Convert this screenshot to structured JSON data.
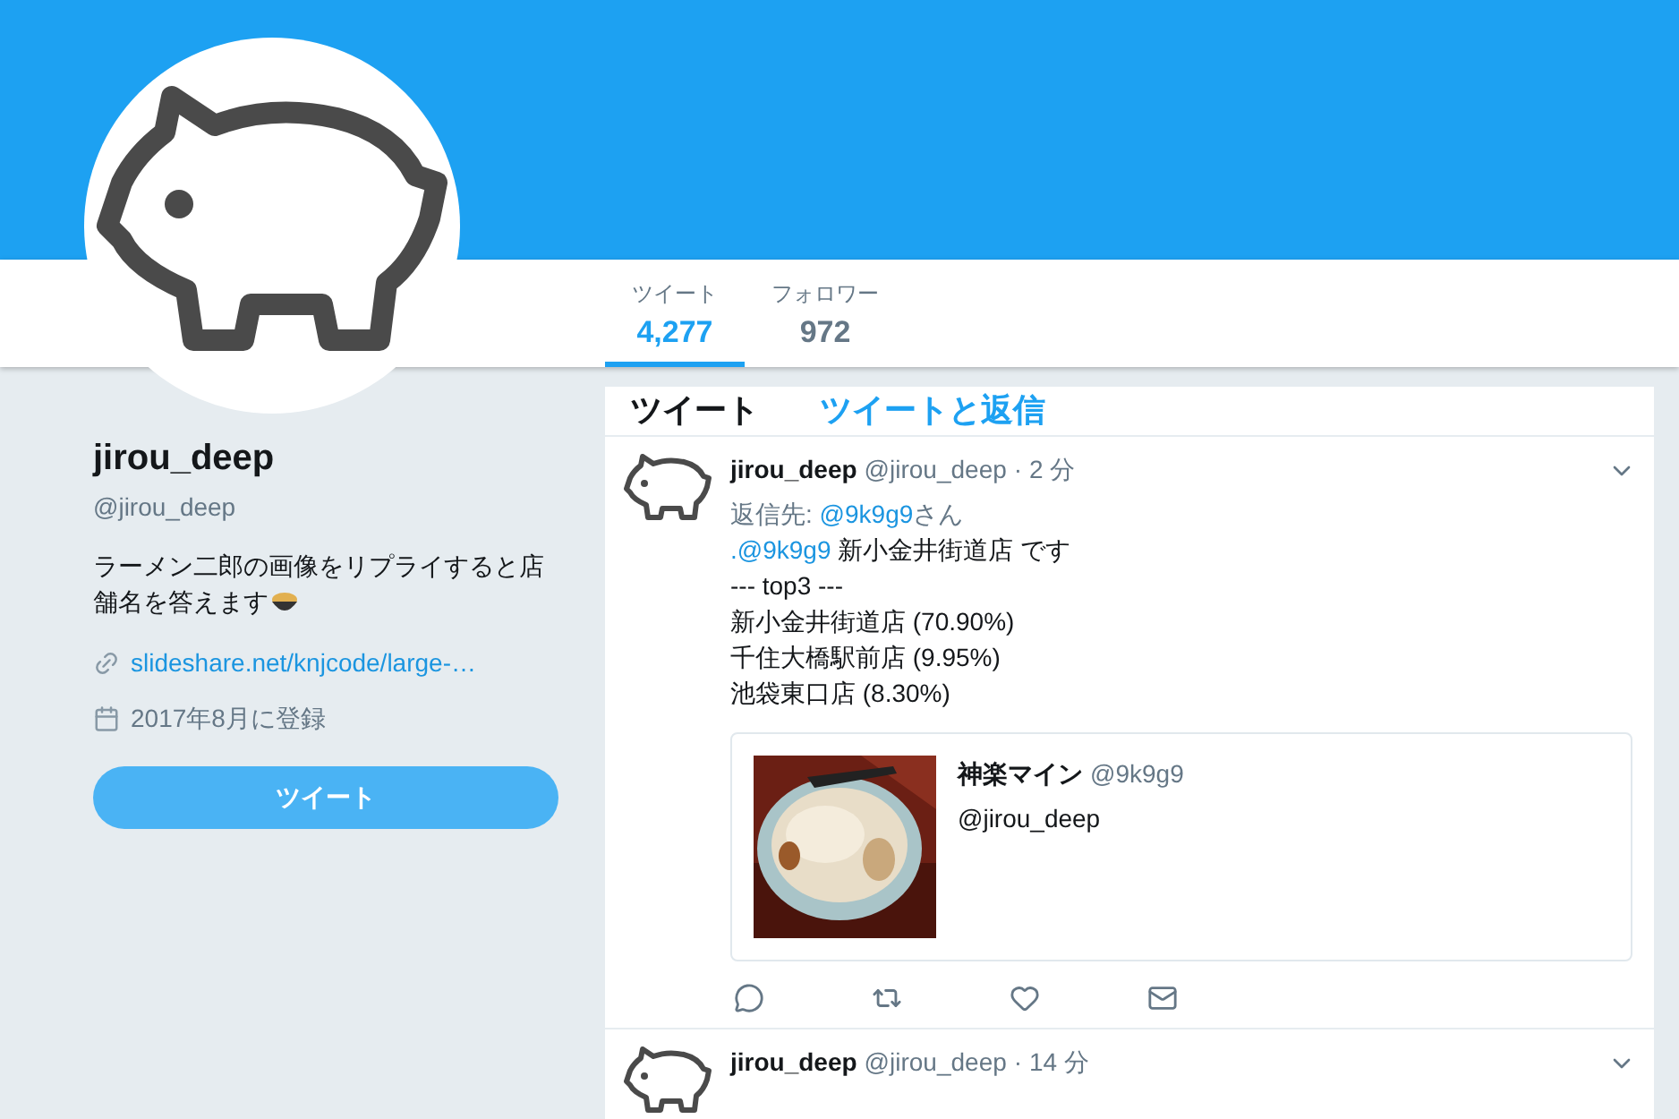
{
  "nav": {
    "stats": [
      {
        "label": "ツイート",
        "value": "4,277",
        "selected": true
      },
      {
        "label": "フォロワー",
        "value": "972",
        "selected": false
      }
    ]
  },
  "profile": {
    "name": "jirou_deep",
    "handle": "@jirou_deep",
    "bio_lines": [
      "ラーメン二郎の画像をリプライすると店",
      "舗名を答えます"
    ],
    "link": "slideshare.net/knjcode/large-…",
    "joined": "2017年8月に登録",
    "tweet_button": "ツイート"
  },
  "timeline": {
    "tabs": [
      {
        "label": "ツイート",
        "selected": true
      },
      {
        "label": "ツイートと返信",
        "selected": false
      }
    ],
    "tweets": [
      {
        "name": "jirou_deep",
        "handle": "@jirou_deep",
        "time": "· 2 分",
        "reply_prefix": "返信先: ",
        "reply_mention": "@9k9g9",
        "reply_suffix": "さん",
        "text_prefix": ".",
        "text_mention": "@9k9g9",
        "text_rest": " 新小金井街道店 です",
        "lines": [
          "--- top3 ---",
          "新小金井街道店 (70.90%)",
          "千住大橋駅前店 (9.95%)",
          "池袋東口店 (8.30%)"
        ],
        "quote": {
          "kind": "picture",
          "name": "神楽マイン",
          "handle": "@9k9g9",
          "text": "@jirou_deep"
        }
      },
      {
        "name": "jirou_deep",
        "handle": "@jirou_deep",
        "time": "· 14 分"
      }
    ]
  }
}
